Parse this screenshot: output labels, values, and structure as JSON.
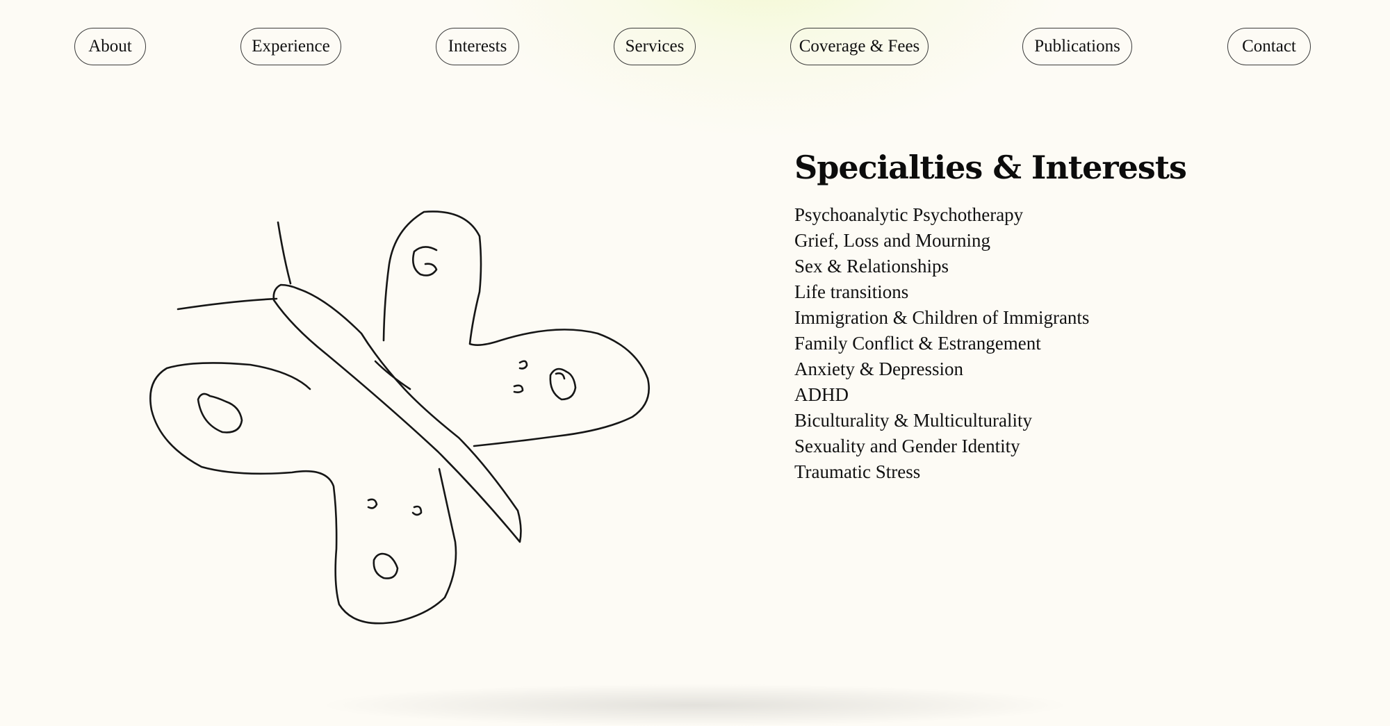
{
  "nav": {
    "items": [
      {
        "label": "About"
      },
      {
        "label": "Experience"
      },
      {
        "label": "Interests"
      },
      {
        "label": "Services"
      },
      {
        "label": "Coverage & Fees"
      },
      {
        "label": "Publications"
      },
      {
        "label": "Contact"
      }
    ]
  },
  "main": {
    "heading": "Specialties & Interests",
    "specialties": [
      "Psychoanalytic Psychotherapy",
      "Grief, Loss and Mourning",
      "Sex & Relationships",
      "Life transitions",
      "Immigration & Children of Immigrants",
      "Family Conflict & Estrangement",
      "Anxiety & Depression",
      "ADHD",
      "Biculturality & Multiculturality",
      "Sexuality and Gender Identity",
      "Traumatic Stress"
    ]
  },
  "illustration": {
    "icon": "butterfly-illustration"
  },
  "colors": {
    "background": "#fdfbf5",
    "glow": "#f0f8c8",
    "text": "#111111",
    "border": "#3a3a3a"
  }
}
